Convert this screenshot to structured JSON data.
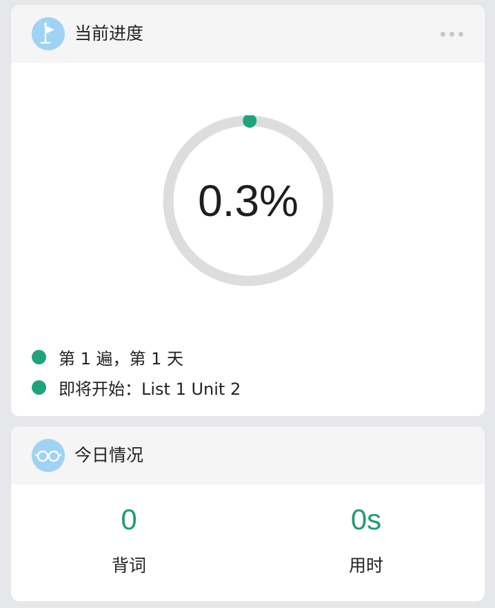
{
  "progress_card": {
    "title": "当前进度",
    "icon": "flag-icon",
    "percent_text": "0.3%",
    "percent_value": 0.3,
    "status_lines": [
      "第 1 遍，第 1 天",
      "即将开始：List 1 Unit 2"
    ]
  },
  "today_card": {
    "title": "今日情况",
    "icon": "glasses-icon",
    "stats": [
      {
        "value": "0",
        "label": "背词"
      },
      {
        "value": "0s",
        "label": "用时"
      }
    ]
  },
  "colors": {
    "accent_green": "#1fa37a",
    "icon_bg": "#9fd3f3",
    "ring_track": "#dddddd",
    "page_bg": "#e6e7ea"
  }
}
